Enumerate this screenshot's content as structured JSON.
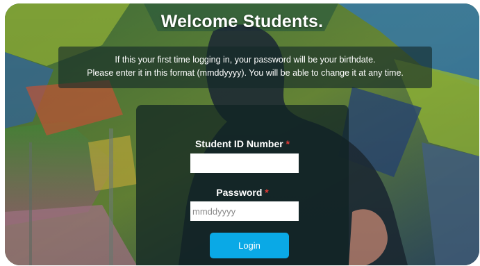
{
  "header": {
    "title": "Welcome Students."
  },
  "info": {
    "line1": "If this your first time logging in, your password will be your birthdate.",
    "line2": "Please enter it in this format (mmddyyyy). You will be able to change it at any time."
  },
  "form": {
    "student_id_label": "Student ID Number",
    "student_id_value": "",
    "password_label": "Password",
    "password_placeholder": "mmddyyyy",
    "required_marker": "*",
    "login_label": "Login"
  },
  "colors": {
    "accent": "#0aa9e6",
    "required": "#e53935"
  }
}
